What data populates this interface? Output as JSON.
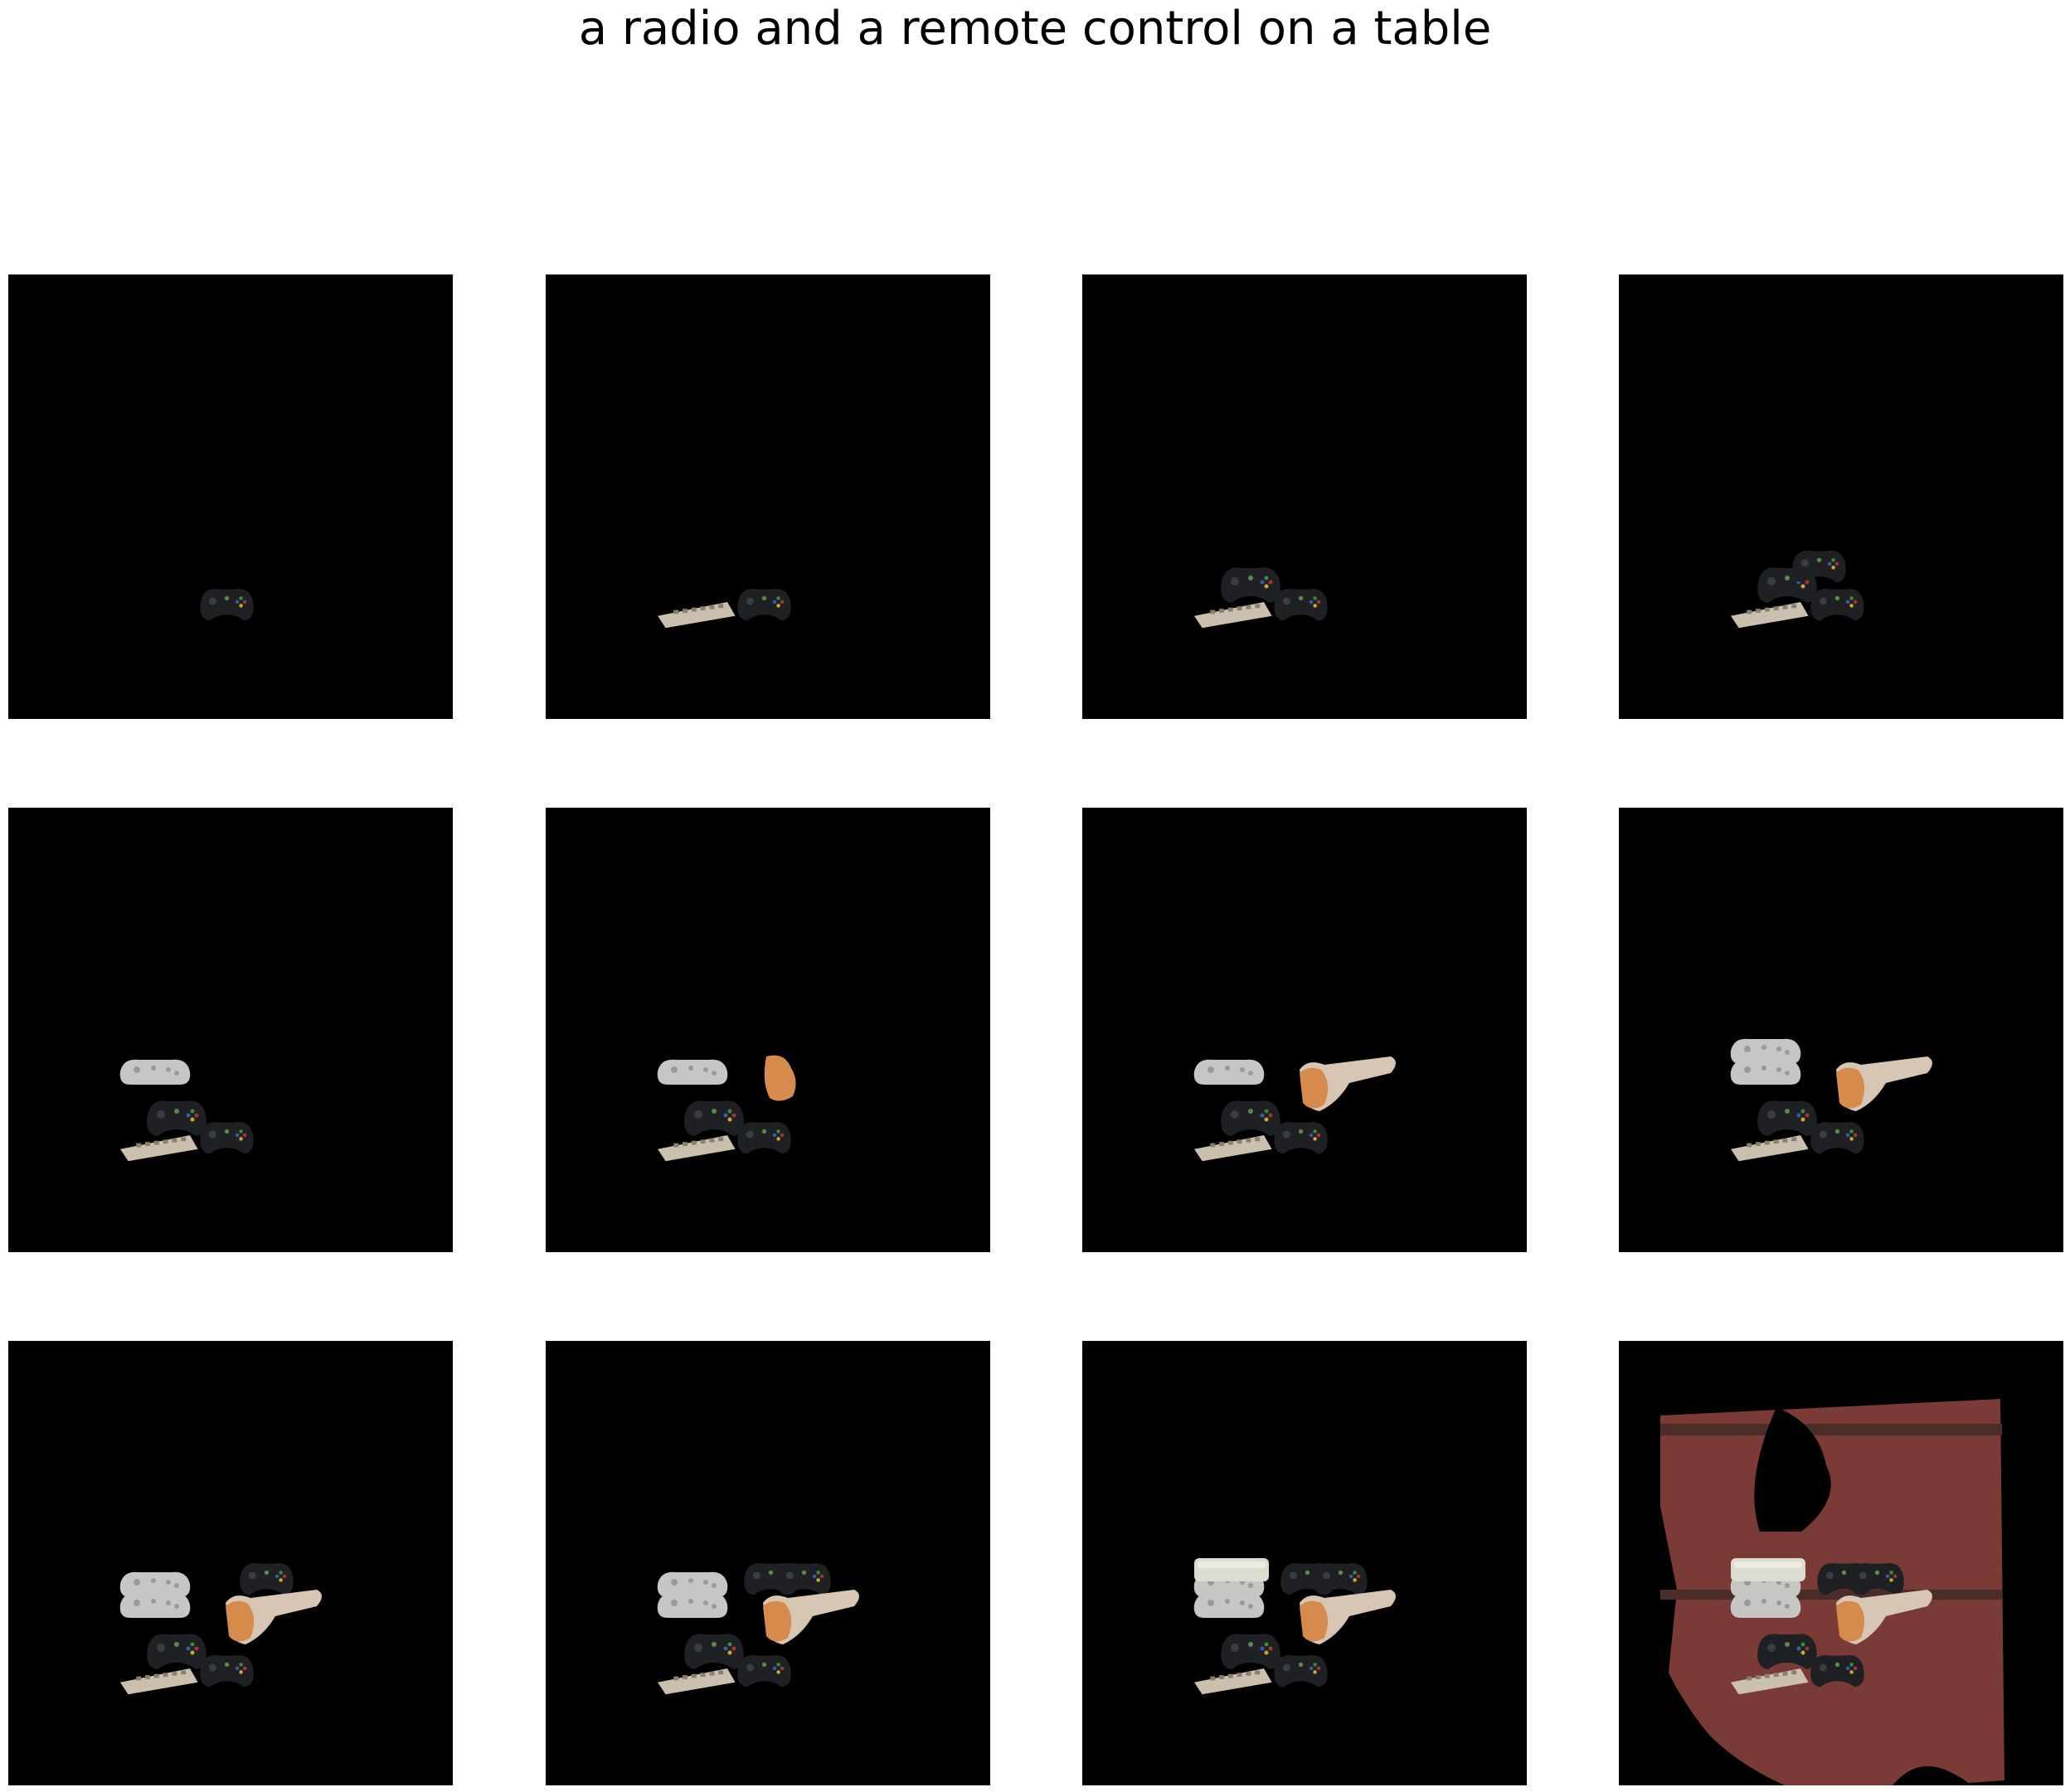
{
  "title": "a radio and a remote control on a table",
  "grid": {
    "rows": 3,
    "columns": 4,
    "panel_count": 12,
    "background_color": "#000000"
  },
  "colors": {
    "figure_background": "#ffffff",
    "panel_background": "#000000",
    "gamepad_dark": "#1e2024",
    "gamepad_light": "#c6c6c4",
    "remote_beige": "#cbbfae",
    "hand_skin": "#d68a4c",
    "hand_pale": "#d8c6b4",
    "wall_red": "#7a3a36",
    "shelf_brown": "#4a2c28"
  }
}
